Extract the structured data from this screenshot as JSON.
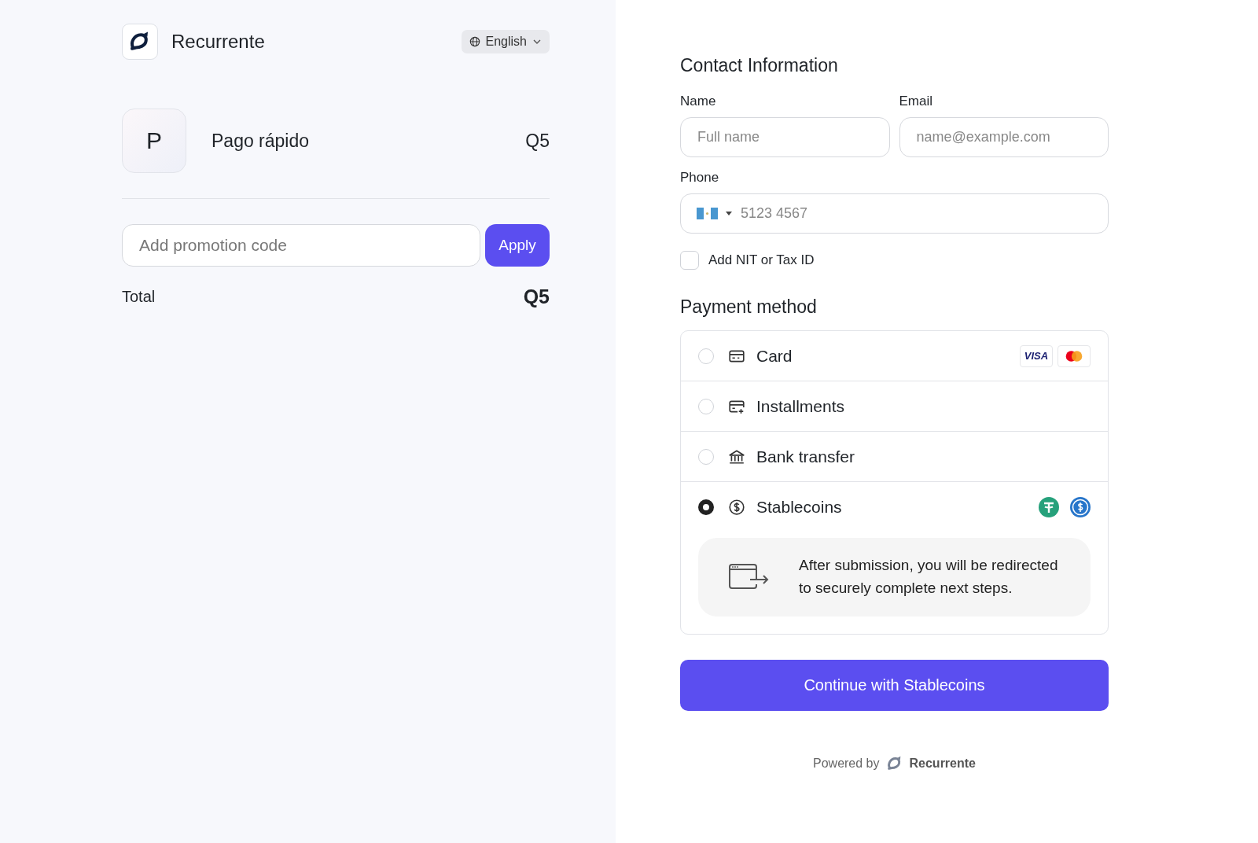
{
  "brand": {
    "name": "Recurrente"
  },
  "language": {
    "label": "English"
  },
  "product": {
    "initial": "P",
    "name": "Pago rápido",
    "price": "Q5"
  },
  "promo": {
    "placeholder": "Add promotion code",
    "button": "Apply"
  },
  "total": {
    "label": "Total",
    "amount": "Q5"
  },
  "contact": {
    "title": "Contact Information",
    "fields": [
      {
        "label": "Name",
        "placeholder": "Full name"
      },
      {
        "label": "Email",
        "placeholder": "name@example.com"
      }
    ],
    "phone": {
      "label": "Phone",
      "placeholder": "5123 4567"
    },
    "tax_id": {
      "label": "Add NIT or Tax ID",
      "checked": false
    }
  },
  "payment": {
    "title": "Payment method",
    "methods": [
      {
        "kind": "card",
        "label": "Card",
        "selected": false,
        "brand_text": "VISA"
      },
      {
        "kind": "installments",
        "label": "Installments",
        "selected": false
      },
      {
        "kind": "bank",
        "label": "Bank transfer",
        "selected": false
      },
      {
        "kind": "stablecoins",
        "label": "Stablecoins",
        "selected": true,
        "note": "After submission, you will be redirected to securely complete next steps."
      }
    ]
  },
  "submit": {
    "label": "Continue with Stablecoins"
  },
  "footer": {
    "prefix": "Powered by",
    "brand": "Recurrente"
  }
}
